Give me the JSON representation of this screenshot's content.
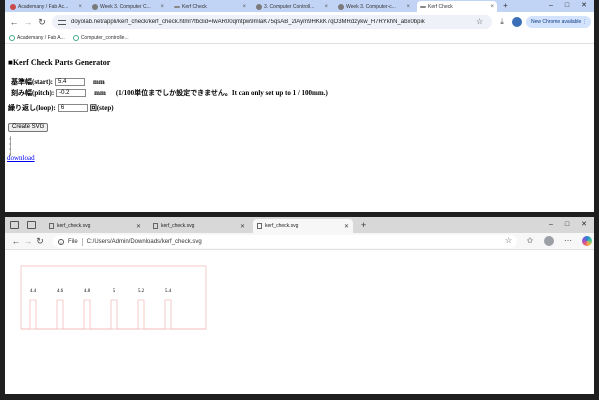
{
  "window1": {
    "tabs": [
      {
        "label": "Academany / Fab Ac..."
      },
      {
        "label": "Week 3. Computer C..."
      },
      {
        "label": "Kerf Check"
      },
      {
        "label": "3. Computer Controll..."
      },
      {
        "label": "Week 3. Computer-c..."
      },
      {
        "label": "Kerf Check"
      }
    ],
    "new_tab": "+",
    "window_controls": {
      "minimize": "–",
      "maximize": "□",
      "close": "✕"
    },
    "nav": {
      "back": "←",
      "forward": "→",
      "reload": "↻"
    },
    "url": "doyolab.net/appli/kerf_check/kerf_check.html?fbclid=IwAR00qmtpw9mlaK75qsAB_2lAym9HKkK7qO3MRdzykw_H7RYkhN_abx0bpik",
    "toolbar_icons": [
      "star-icon",
      "download-icon",
      "avatar",
      "menu-icon"
    ],
    "update_button": {
      "label": "New Chrome available",
      "kebab": "⋮"
    },
    "bookmarks": [
      {
        "label": "Academany / Fab A..."
      },
      {
        "label": "Computer_controlle..."
      }
    ],
    "page": {
      "title": "■Kerf Check Parts Generator",
      "start": {
        "label": "基準幅(start):",
        "value": "5.4",
        "unit": "mm"
      },
      "pitch": {
        "label": "刻み幅(pitch):",
        "value": "-0.2",
        "unit": "mm",
        "note": "(1/100単位までしか設定できません。It can only set up to 1 / 100mm.)"
      },
      "loop": {
        "label": "繰り返し(loop):",
        "value": "6",
        "unit": "回(step)"
      },
      "create_button": "Create SVG",
      "download_link": "download"
    }
  },
  "window2": {
    "tabs": [
      {
        "label": "kerf_check.svg"
      },
      {
        "label": "kerf_check.svg"
      },
      {
        "label": "kerf_check.svg"
      }
    ],
    "new_tab": "+",
    "window_controls": {
      "minimize": "–",
      "maximize": "□",
      "close": "✕"
    },
    "nav": {
      "back": "←",
      "forward": "→",
      "reload": "↻"
    },
    "address": {
      "prefix": "File",
      "path": "C:/Users/Admin/Downloads/kerf_check.svg"
    },
    "toolbar_icons": [
      "favorite-icon",
      "collections-icon",
      "profile-avatar",
      "more-icon",
      "copilot-icon"
    ],
    "svg": {
      "stroke_color": "#f0a8a8",
      "labels": [
        "4.4",
        "4.6",
        "4.8",
        "5",
        "5.2",
        "5.4"
      ]
    }
  }
}
